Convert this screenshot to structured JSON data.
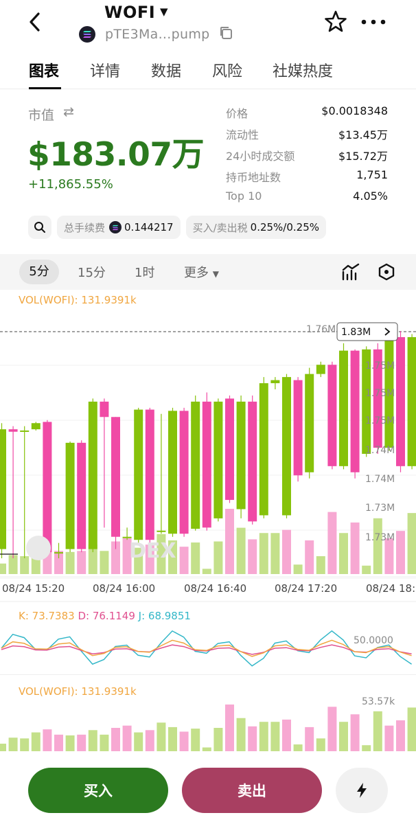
{
  "header": {
    "title": "WOFI",
    "address": "pTE3Ma...pump"
  },
  "tabs": [
    {
      "label": "图表",
      "active": true
    },
    {
      "label": "详情"
    },
    {
      "label": "数据"
    },
    {
      "label": "风险"
    },
    {
      "label": "社媒热度"
    }
  ],
  "market": {
    "cap_label": "市值",
    "cap_value": "$183.07万",
    "change": "+11,865.55%"
  },
  "stats": [
    {
      "label": "价格",
      "value": "$0.0018348"
    },
    {
      "label": "流动性",
      "value": "$13.45万"
    },
    {
      "label": "24小时成交额",
      "value": "$15.72万"
    },
    {
      "label": "持币地址数",
      "value": "1,751"
    },
    {
      "label": "Top 10",
      "value": "4.05%"
    }
  ],
  "chips": {
    "fee_label": "总手续费",
    "fee_value": "0.144217",
    "tax_label": "买入/卖出税",
    "tax_value": "0.25%/0.25%"
  },
  "intervals": {
    "items": [
      "5分",
      "15分",
      "1时",
      "更多"
    ],
    "active": "5分"
  },
  "chart_data": {
    "type": "candlestick",
    "vol_legend": "VOL(WOFI): 131.9391k",
    "high_label": "1.76M",
    "last_price_tag": "1.83M",
    "y_labels": [
      "1.76M",
      "1.75M",
      "1.75M",
      "1.75M",
      "1.74M",
      "1.74M",
      "1.73M",
      "1.73M"
    ],
    "x_labels": [
      "08/24 15:20",
      "08/24 16:00",
      "08/24 16:40",
      "08/24 17:20",
      "08/24 18:"
    ],
    "watermark": "DEX",
    "colors": {
      "up": "#86c20a",
      "down": "#f04aa5",
      "up_vol": "#c4e08a",
      "down_vol": "#f7a8d2"
    },
    "kdj": {
      "k": "K: 73.7383",
      "d": "D: 76.1149",
      "j": "J: 68.9851",
      "level": "50.0000"
    },
    "vol2_legend": "VOL(WOFI): 131.9391k",
    "vol2_max": "53.57k",
    "candles": [
      {
        "o": 1.7345,
        "c": 1.754,
        "h": 1.755,
        "l": 1.733
      },
      {
        "o": 1.754,
        "c": 1.7536,
        "h": 1.7545,
        "l": 1.733
      },
      {
        "o": 1.7536,
        "c": 1.7538,
        "h": 1.7545,
        "l": 1.733
      },
      {
        "o": 1.754,
        "c": 1.755,
        "h": 1.7552,
        "l": 1.7538
      },
      {
        "o": 1.7552,
        "c": 1.734,
        "h": 1.7555,
        "l": 1.7335
      },
      {
        "o": 1.734,
        "c": 1.734,
        "h": 1.7355,
        "l": 1.733
      },
      {
        "o": 1.7345,
        "c": 1.7518,
        "h": 1.752,
        "l": 1.734
      },
      {
        "o": 1.7518,
        "c": 1.7345,
        "h": 1.7522,
        "l": 1.734
      },
      {
        "o": 1.7345,
        "c": 1.7585,
        "h": 1.759,
        "l": 1.734
      },
      {
        "o": 1.7585,
        "c": 1.756,
        "h": 1.759,
        "l": 1.738
      },
      {
        "o": 1.756,
        "c": 1.7365,
        "h": 1.756,
        "l": 1.7345
      },
      {
        "o": 1.7365,
        "c": 1.7365,
        "h": 1.738,
        "l": 1.736
      },
      {
        "o": 1.736,
        "c": 1.7572,
        "h": 1.7575,
        "l": 1.7355
      },
      {
        "o": 1.7572,
        "c": 1.736,
        "h": 1.7575,
        "l": 1.7355
      },
      {
        "o": 1.7375,
        "c": 1.7375,
        "h": 1.7565,
        "l": 1.737
      },
      {
        "o": 1.737,
        "c": 1.757,
        "h": 1.7575,
        "l": 1.7365
      },
      {
        "o": 1.757,
        "c": 1.737,
        "h": 1.7575,
        "l": 1.7365
      },
      {
        "o": 1.7378,
        "c": 1.7585,
        "h": 1.7595,
        "l": 1.7375
      },
      {
        "o": 1.7585,
        "c": 1.738,
        "h": 1.76,
        "l": 1.7375
      },
      {
        "o": 1.7395,
        "c": 1.7585,
        "h": 1.759,
        "l": 1.739
      },
      {
        "o": 1.759,
        "c": 1.7425,
        "h": 1.7595,
        "l": 1.742
      },
      {
        "o": 1.741,
        "c": 1.7585,
        "h": 1.7595,
        "l": 1.7395
      },
      {
        "o": 1.7585,
        "c": 1.739,
        "h": 1.7595,
        "l": 1.7385
      },
      {
        "o": 1.74,
        "c": 1.7615,
        "h": 1.7625,
        "l": 1.7395
      },
      {
        "o": 1.7615,
        "c": 1.762,
        "h": 1.7625,
        "l": 1.7605
      },
      {
        "o": 1.74,
        "c": 1.7625,
        "h": 1.763,
        "l": 1.7395
      },
      {
        "o": 1.762,
        "c": 1.7465,
        "h": 1.7625,
        "l": 1.7455
      },
      {
        "o": 1.747,
        "c": 1.763,
        "h": 1.764,
        "l": 1.746
      },
      {
        "o": 1.763,
        "c": 1.7645,
        "h": 1.765,
        "l": 1.7625
      },
      {
        "o": 1.7645,
        "c": 1.748,
        "h": 1.765,
        "l": 1.7475
      },
      {
        "o": 1.748,
        "c": 1.7668,
        "h": 1.768,
        "l": 1.7475
      },
      {
        "o": 1.7668,
        "c": 1.747,
        "h": 1.767,
        "l": 1.746
      },
      {
        "o": 1.75,
        "c": 1.767,
        "h": 1.7675,
        "l": 1.7495
      },
      {
        "o": 1.767,
        "c": 1.751,
        "h": 1.768,
        "l": 1.75
      },
      {
        "o": 1.751,
        "c": 1.769,
        "h": 1.769,
        "l": 1.7505
      },
      {
        "o": 1.769,
        "c": 1.748,
        "h": 1.77,
        "l": 1.747
      },
      {
        "o": 1.748,
        "c": 1.769,
        "h": 1.7695,
        "l": 1.7475
      }
    ],
    "volumes": [
      {
        "v": 0.1,
        "up": true
      },
      {
        "v": 0.18,
        "up": true
      },
      {
        "v": 0.17,
        "up": true
      },
      {
        "v": 0.25,
        "up": true
      },
      {
        "v": 0.29,
        "up": false
      },
      {
        "v": 0.22,
        "up": false
      },
      {
        "v": 0.21,
        "up": true
      },
      {
        "v": 0.22,
        "up": false
      },
      {
        "v": 0.28,
        "up": true
      },
      {
        "v": 0.22,
        "up": true
      },
      {
        "v": 0.31,
        "up": false
      },
      {
        "v": 0.34,
        "up": false
      },
      {
        "v": 0.25,
        "up": true
      },
      {
        "v": 0.28,
        "up": false
      },
      {
        "v": 0.38,
        "up": true
      },
      {
        "v": 0.32,
        "up": true
      },
      {
        "v": 0.26,
        "up": false
      },
      {
        "v": 0.3,
        "up": true
      },
      {
        "v": 0.05,
        "up": true
      },
      {
        "v": 0.31,
        "up": true
      },
      {
        "v": 0.62,
        "up": false
      },
      {
        "v": 0.44,
        "up": true
      },
      {
        "v": 0.33,
        "up": false
      },
      {
        "v": 0.39,
        "up": true
      },
      {
        "v": 0.39,
        "up": true
      },
      {
        "v": 0.42,
        "up": false
      },
      {
        "v": 0.09,
        "up": true
      },
      {
        "v": 0.32,
        "up": false
      },
      {
        "v": 0.17,
        "up": true
      },
      {
        "v": 0.59,
        "up": false
      },
      {
        "v": 0.39,
        "up": true
      },
      {
        "v": 0.49,
        "up": false
      },
      {
        "v": 0.08,
        "up": true
      },
      {
        "v": 0.53,
        "up": true
      },
      {
        "v": 0.34,
        "up": false
      },
      {
        "v": 0.41,
        "up": false
      },
      {
        "v": 0.58,
        "up": true
      }
    ]
  }
}
